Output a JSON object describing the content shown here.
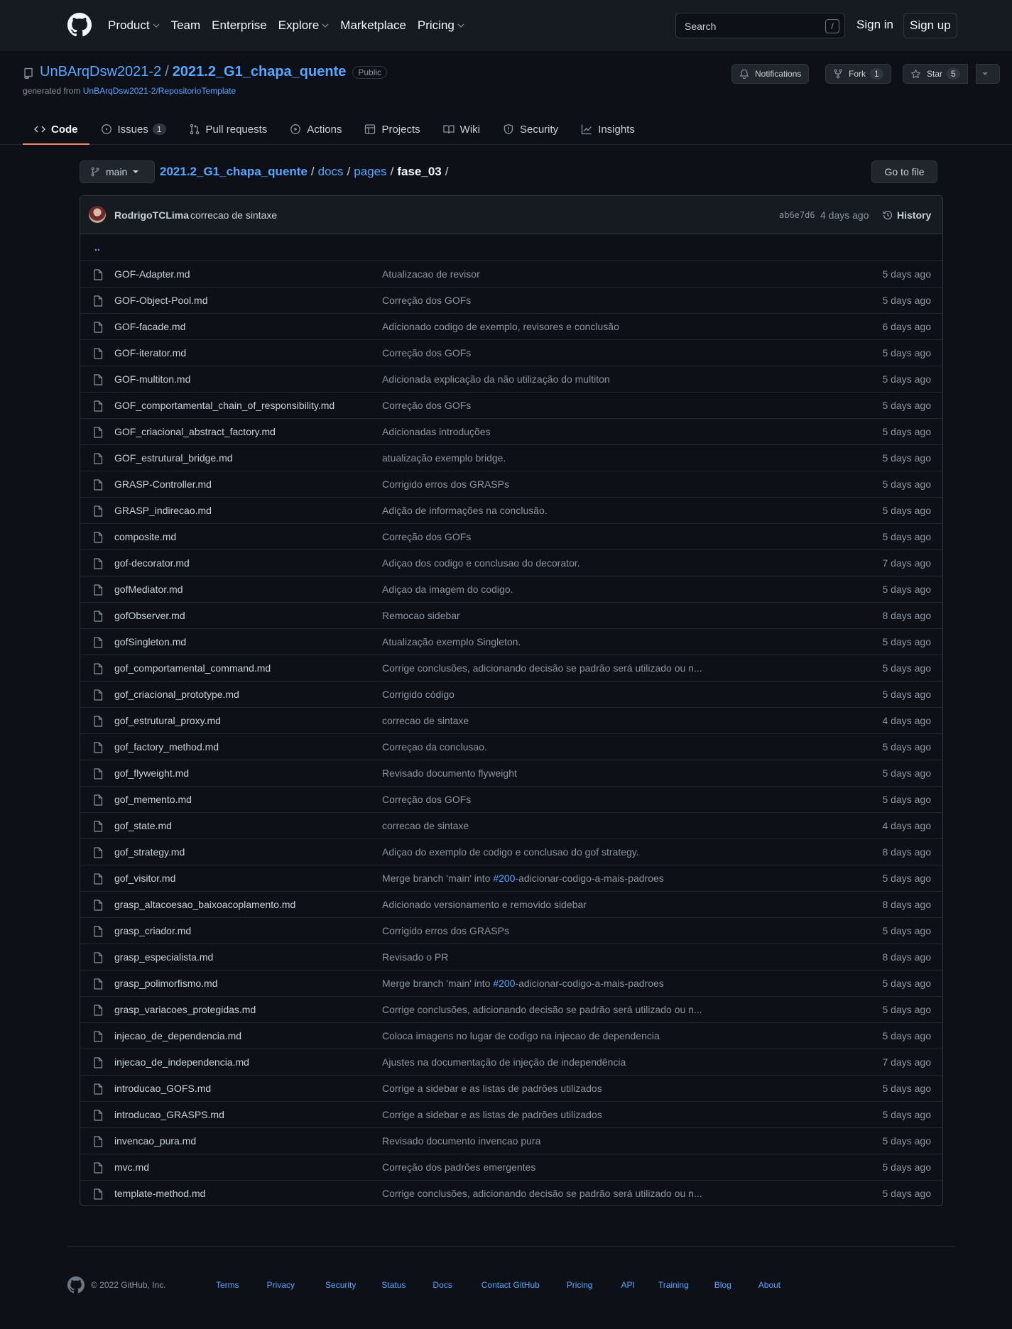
{
  "header": {
    "nav": [
      "Product",
      "Team",
      "Enterprise",
      "Explore",
      "Marketplace",
      "Pricing"
    ],
    "search_placeholder": "Search",
    "search_shortcut": "/",
    "sign_in": "Sign in",
    "sign_up": "Sign up"
  },
  "repo": {
    "owner": "UnBArqDsw2021-2",
    "separator": "/",
    "name": "2021.2_G1_chapa_quente",
    "visibility": "Public",
    "generated_from_prefix": "generated from",
    "generated_from_link": "UnBArqDsw2021-2/RepositorioTemplate",
    "notifications_label": "Notifications",
    "fork_label": "Fork",
    "fork_count": "1",
    "star_label": "Star",
    "star_count": "5"
  },
  "tabs": [
    {
      "label": "Code",
      "counter": ""
    },
    {
      "label": "Issues",
      "counter": "1"
    },
    {
      "label": "Pull requests",
      "counter": ""
    },
    {
      "label": "Actions",
      "counter": ""
    },
    {
      "label": "Projects",
      "counter": ""
    },
    {
      "label": "Wiki",
      "counter": ""
    },
    {
      "label": "Security",
      "counter": ""
    },
    {
      "label": "Insights",
      "counter": ""
    }
  ],
  "breadcrumb": {
    "branch": "main",
    "repo": "2021.2_G1_chapa_quente",
    "docs": "docs",
    "pages": "pages",
    "current": "fase_03",
    "sep": "/",
    "go_to_file": "Go to file"
  },
  "commit": {
    "author": "RodrigoTCLima",
    "message": "correcao de sintaxe",
    "sha": "ab6e7d6",
    "date": "4 days ago",
    "history": "History"
  },
  "parent_dir": "..",
  "files": [
    {
      "name": "GOF-Adapter.md",
      "message": "Atualizacao de revisor",
      "age": "5 days ago"
    },
    {
      "name": "GOF-Object-Pool.md",
      "message": "Correção dos GOFs",
      "age": "5 days ago"
    },
    {
      "name": "GOF-facade.md",
      "message": "Adicionado codigo de exemplo, revisores e conclusão",
      "age": "6 days ago"
    },
    {
      "name": "GOF-iterator.md",
      "message": "Correção dos GOFs",
      "age": "5 days ago"
    },
    {
      "name": "GOF-multiton.md",
      "message": "Adicionada explicação da não utilização do multiton",
      "age": "5 days ago"
    },
    {
      "name": "GOF_comportamental_chain_of_responsibility.md",
      "message": "Correção dos GOFs",
      "age": "5 days ago"
    },
    {
      "name": "GOF_criacional_abstract_factory.md",
      "message": "Adicionadas introduções",
      "age": "5 days ago"
    },
    {
      "name": "GOF_estrutural_bridge.md",
      "message": "atualização exemplo bridge.",
      "age": "5 days ago"
    },
    {
      "name": "GRASP-Controller.md",
      "message": "Corrigido erros dos GRASPs",
      "age": "5 days ago"
    },
    {
      "name": "GRASP_indirecao.md",
      "message": "Adição de informações na conclusão.",
      "age": "5 days ago"
    },
    {
      "name": "composite.md",
      "message": "Correção dos GOFs",
      "age": "5 days ago"
    },
    {
      "name": "gof-decorator.md",
      "message": "Adiçao dos codigo e conclusao do decorator.",
      "age": "7 days ago"
    },
    {
      "name": "gofMediator.md",
      "message": "Adiçao da imagem do codigo.",
      "age": "5 days ago"
    },
    {
      "name": "gofObserver.md",
      "message": "Remocao sidebar",
      "age": "8 days ago"
    },
    {
      "name": "gofSingleton.md",
      "message": "Atualização exemplo Singleton.",
      "age": "5 days ago"
    },
    {
      "name": "gof_comportamental_command.md",
      "message": "Corrige conclusões, adicionando decisão se padrão será utilizado ou n...",
      "age": "5 days ago"
    },
    {
      "name": "gof_criacional_prototype.md",
      "message": "Corrigido código",
      "age": "5 days ago"
    },
    {
      "name": "gof_estrutural_proxy.md",
      "message": "correcao de sintaxe",
      "age": "4 days ago"
    },
    {
      "name": "gof_factory_method.md",
      "message": "Correçao da conclusao.",
      "age": "5 days ago"
    },
    {
      "name": "gof_flyweight.md",
      "message": "Revisado documento flyweight",
      "age": "5 days ago"
    },
    {
      "name": "gof_memento.md",
      "message": "Correção dos GOFs",
      "age": "5 days ago"
    },
    {
      "name": "gof_state.md",
      "message": "correcao de sintaxe",
      "age": "4 days ago"
    },
    {
      "name": "gof_strategy.md",
      "message": "Adiçao do exemplo de codigo e conclusao do gof strategy.",
      "age": "8 days ago"
    },
    {
      "name": "gof_visitor.md",
      "message_pre": "Merge branch 'main' into ",
      "issue": "#200",
      "message_post": "-adicionar-codigo-a-mais-padroes",
      "age": "5 days ago"
    },
    {
      "name": "grasp_altacoesao_baixoacoplamento.md",
      "message": "Adicionado versionamento e removido sidebar",
      "age": "8 days ago"
    },
    {
      "name": "grasp_criador.md",
      "message": "Corrigido erros dos GRASPs",
      "age": "5 days ago"
    },
    {
      "name": "grasp_especialista.md",
      "message": "Revisado o PR",
      "age": "8 days ago"
    },
    {
      "name": "grasp_polimorfismo.md",
      "message_pre": "Merge branch 'main' into ",
      "issue": "#200",
      "message_post": "-adicionar-codigo-a-mais-padroes",
      "age": "5 days ago"
    },
    {
      "name": "grasp_variacoes_protegidas.md",
      "message": "Corrige conclusões, adicionando decisão se padrão será utilizado ou n...",
      "age": "5 days ago"
    },
    {
      "name": "injecao_de_dependencia.md",
      "message": "Coloca imagens no lugar de codigo na injecao de dependencia",
      "age": "5 days ago"
    },
    {
      "name": "injecao_de_independencia.md",
      "message": "Ajustes na documentação de injeção de independência",
      "age": "7 days ago"
    },
    {
      "name": "introducao_GOFS.md",
      "message": "Corrige a sidebar e as listas de padrões utilizados",
      "age": "5 days ago"
    },
    {
      "name": "introducao_GRASPS.md",
      "message": "Corrige a sidebar e as listas de padrões utilizados",
      "age": "5 days ago"
    },
    {
      "name": "invencao_pura.md",
      "message": "Revisado documento invencao pura",
      "age": "5 days ago"
    },
    {
      "name": "mvc.md",
      "message": "Correção dos padrões emergentes",
      "age": "5 days ago"
    },
    {
      "name": "template-method.md",
      "message": "Corrige conclusões, adicionando decisão se padrão será utilizado ou n...",
      "age": "5 days ago"
    }
  ],
  "footer": {
    "copyright": "© 2022 GitHub, Inc.",
    "links": [
      "Terms",
      "Privacy",
      "Security",
      "Status",
      "Docs",
      "Contact GitHub",
      "Pricing",
      "API",
      "Training",
      "Blog",
      "About"
    ]
  }
}
